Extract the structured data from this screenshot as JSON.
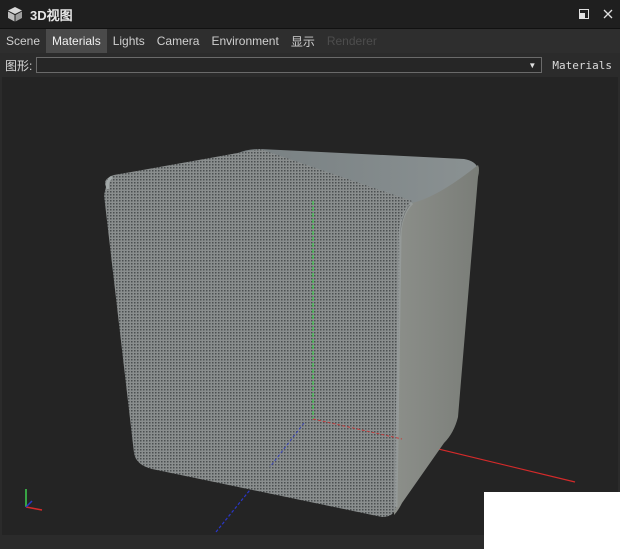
{
  "window": {
    "title": "3D视图",
    "icon": "cube-icon"
  },
  "tabs": [
    {
      "label": "Scene",
      "state": "normal"
    },
    {
      "label": "Materials",
      "state": "active"
    },
    {
      "label": "Lights",
      "state": "normal"
    },
    {
      "label": "Camera",
      "state": "normal"
    },
    {
      "label": "Environment",
      "state": "normal"
    },
    {
      "label": "显示",
      "state": "normal"
    },
    {
      "label": "Renderer",
      "state": "disabled"
    }
  ],
  "toolbar": {
    "shape_label": "图形:",
    "shape_value": "",
    "materials_button": "Materials"
  },
  "viewport": {
    "axis_colors": {
      "x": "#d42a2a",
      "y": "#3fcf4f",
      "z": "#2a36c8"
    },
    "background": "#242424"
  }
}
